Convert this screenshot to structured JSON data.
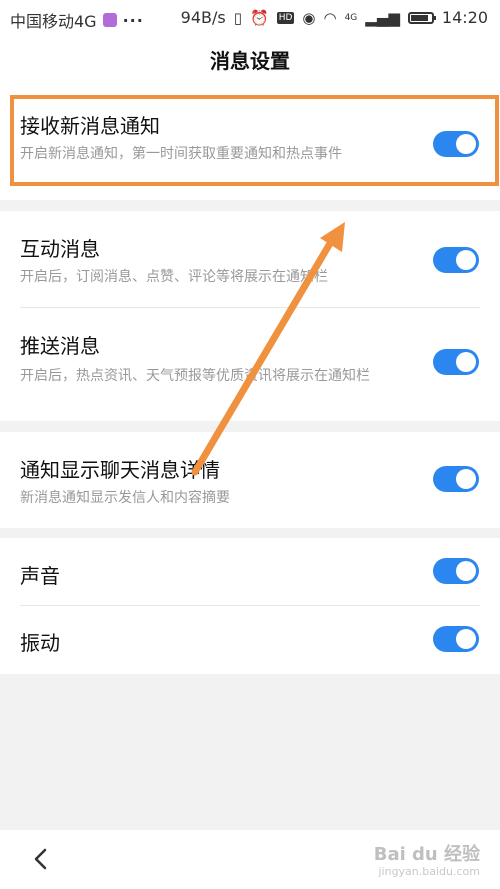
{
  "status_bar": {
    "carrier": "中国移动4G",
    "dots": "···",
    "speed": "94B/s",
    "network_label": "4G",
    "hd_label": "HD",
    "time": "14:20"
  },
  "header": {
    "title": "消息设置"
  },
  "settings": {
    "receive_new": {
      "title": "接收新消息通知",
      "desc": "开启新消息通知，第一时间获取重要通知和热点事件",
      "enabled": true
    },
    "interaction": {
      "title": "互动消息",
      "desc": "开启后，订阅消息、点赞、评论等将展示在通知栏",
      "enabled": true
    },
    "push": {
      "title": "推送消息",
      "desc": "开启后，热点资讯、天气预报等优质资讯将展示在通知栏",
      "enabled": true
    },
    "chat_detail": {
      "title": "通知显示聊天消息详情",
      "desc": "新消息通知显示发信人和内容摘要",
      "enabled": true
    },
    "sound": {
      "title": "声音",
      "enabled": true
    },
    "vibrate": {
      "title": "振动",
      "enabled": true
    }
  },
  "watermark": {
    "main": "Bai du 经验",
    "sub": "jingyan.baidu.com"
  },
  "colors": {
    "toggle_on": "#2b86f0",
    "highlight": "#f0913f",
    "background": "#f2f2f2"
  }
}
